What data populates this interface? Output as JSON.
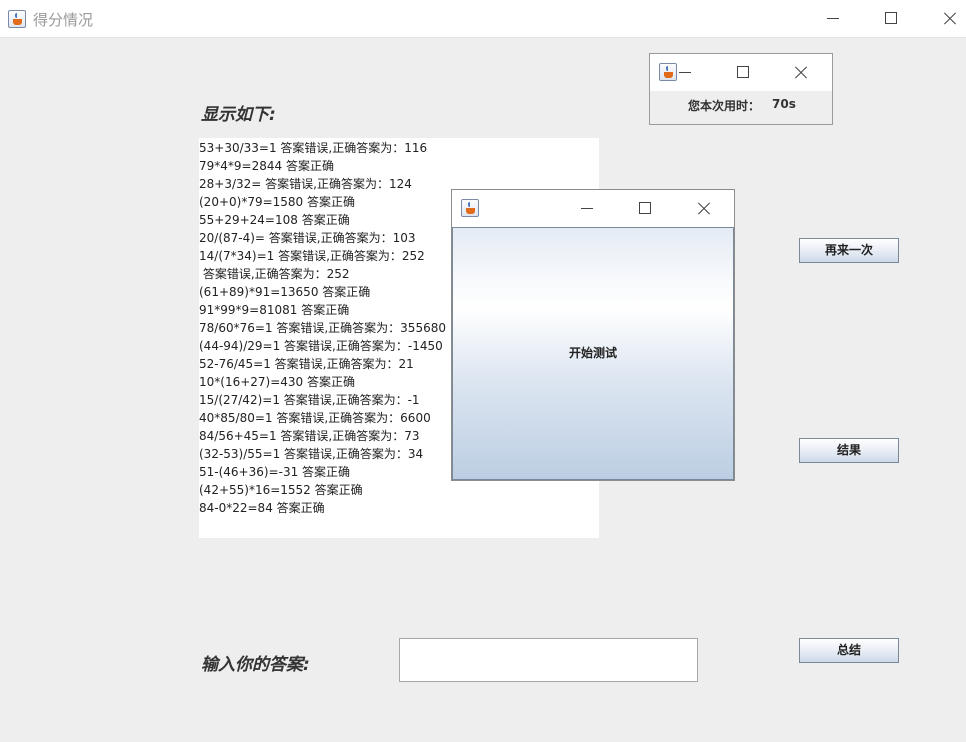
{
  "window": {
    "title": "得分情况"
  },
  "display_label": "显示如下:",
  "results": [
    "53+30/33=1 答案错误,正确答案为：116",
    "79*4*9=2844 答案正确",
    "28+3/32= 答案错误,正确答案为：124",
    "(20+0)*79=1580 答案正确",
    "55+29+24=108 答案正确",
    "20/(87-4)= 答案错误,正确答案为：103",
    "14/(7*34)=1 答案错误,正确答案为：252",
    " 答案错误,正确答案为：252",
    "(61+89)*91=13650 答案正确",
    "91*99*9=81081 答案正确",
    "78/60*76=1 答案错误,正确答案为：355680",
    "(44-94)/29=1 答案错误,正确答案为：-1450",
    "52-76/45=1 答案错误,正确答案为：21",
    "10*(16+27)=430 答案正确",
    "15/(27/42)=1 答案错误,正确答案为：-1",
    "40*85/80=1 答案错误,正确答案为：6600",
    "84/56+45=1 答案错误,正确答案为：73",
    "(32-53)/55=1 答案错误,正确答案为：34",
    "51-(46+36)=-31 答案正确",
    "(42+55)*16=1552 答案正确",
    "84-0*22=84 答案正确"
  ],
  "buttons": {
    "retry": "再来一次",
    "result": "结果",
    "summary": "总结"
  },
  "answer": {
    "label": "输入你的答案:",
    "value": ""
  },
  "timer_window": {
    "label": "您本次用时：",
    "value": "70s"
  },
  "start_window": {
    "button": "开始测试"
  }
}
